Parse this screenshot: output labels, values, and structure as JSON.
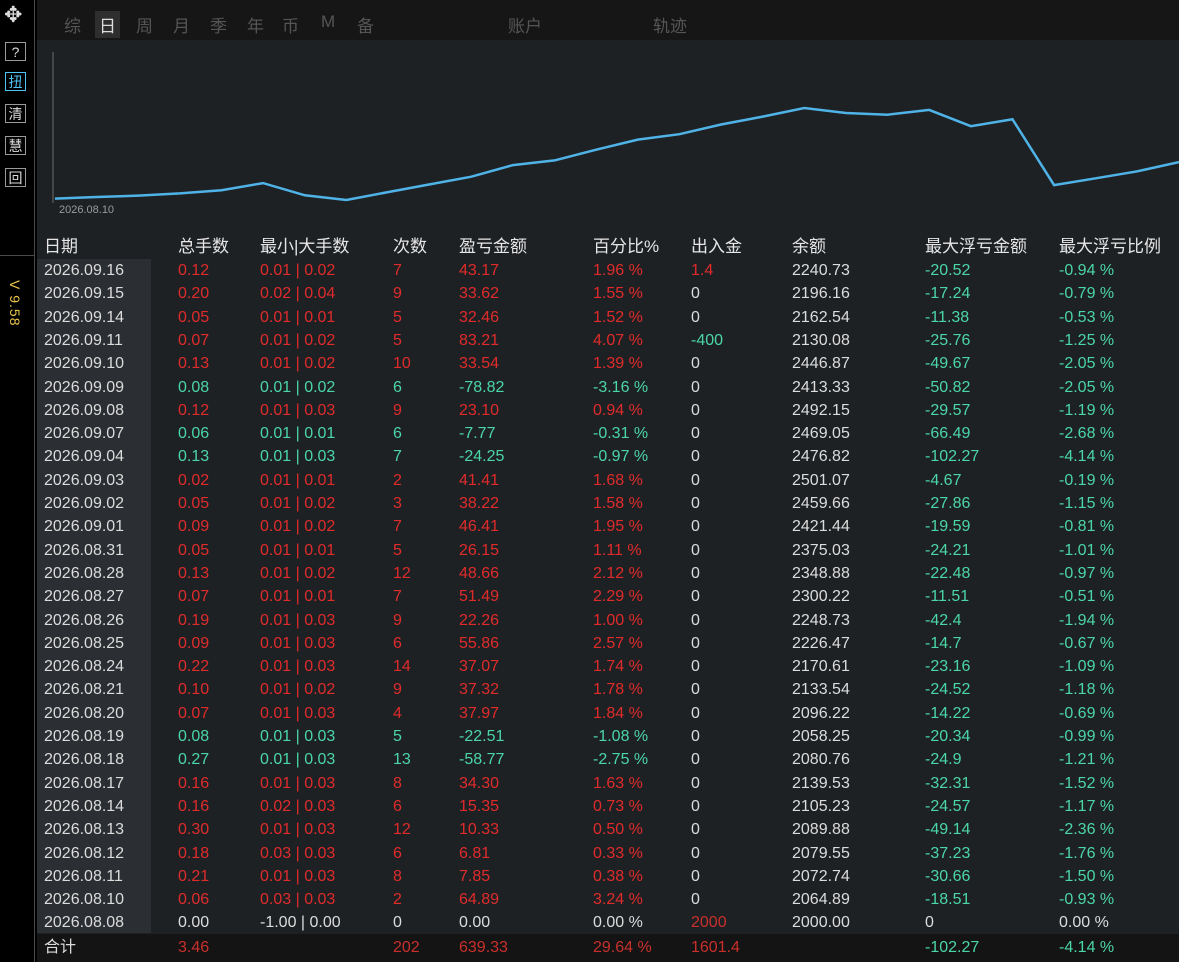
{
  "side": {
    "move_glyph": "✥",
    "buttons": [
      "?",
      "扭",
      "清",
      "慧",
      "回"
    ],
    "version": "V 9.58"
  },
  "tabs": [
    "综",
    "日",
    "周",
    "月",
    "季",
    "年",
    "币",
    "M",
    "备",
    "账户",
    "轨迹"
  ],
  "active_tab": "日",
  "chart": {
    "start_label": "2026.08.10",
    "line_color": "#4fb3e8",
    "balances": [
      2064.89,
      2072.74,
      2079.55,
      2089.88,
      2105.23,
      2139.53,
      2080.76,
      2058.25,
      2096.22,
      2133.54,
      2170.61,
      2226.47,
      2248.73,
      2300.22,
      2348.88,
      2375.03,
      2421.44,
      2459.66,
      2501.07,
      2476.82,
      2469.05,
      2492.15,
      2413.33,
      2446.87,
      2130.08,
      2162.54,
      2196.16,
      2240.73
    ]
  },
  "table": {
    "headers": [
      "日期",
      "总手数",
      "最小|大手数",
      "次数",
      "盈亏金额",
      "百分比%",
      "出入金",
      "余额",
      "最大浮亏金额",
      "最大浮亏比例"
    ],
    "rows": [
      {
        "date": "2026.09.16",
        "lots": "0.12",
        "range": "0.01 | 0.02",
        "count": "7",
        "pnl": "43.17",
        "pct": "1.96 %",
        "io": "1.4",
        "bal": "2240.73",
        "maxdd": "-20.52",
        "maxddpct": "-0.94 %",
        "tone": "r"
      },
      {
        "date": "2026.09.15",
        "lots": "0.20",
        "range": "0.02 | 0.04",
        "count": "9",
        "pnl": "33.62",
        "pct": "1.55 %",
        "io": "0",
        "bal": "2196.16",
        "maxdd": "-17.24",
        "maxddpct": "-0.79 %",
        "tone": "r"
      },
      {
        "date": "2026.09.14",
        "lots": "0.05",
        "range": "0.01 | 0.01",
        "count": "5",
        "pnl": "32.46",
        "pct": "1.52 %",
        "io": "0",
        "bal": "2162.54",
        "maxdd": "-11.38",
        "maxddpct": "-0.53 %",
        "tone": "r"
      },
      {
        "date": "2026.09.11",
        "lots": "0.07",
        "range": "0.01 | 0.02",
        "count": "5",
        "pnl": "83.21",
        "pct": "4.07 %",
        "io": "-400",
        "bal": "2130.08",
        "maxdd": "-25.76",
        "maxddpct": "-1.25 %",
        "tone": "r"
      },
      {
        "date": "2026.09.10",
        "lots": "0.13",
        "range": "0.01 | 0.02",
        "count": "10",
        "pnl": "33.54",
        "pct": "1.39 %",
        "io": "0",
        "bal": "2446.87",
        "maxdd": "-49.67",
        "maxddpct": "-2.05 %",
        "tone": "r"
      },
      {
        "date": "2026.09.09",
        "lots": "0.08",
        "range": "0.01 | 0.02",
        "count": "6",
        "pnl": "-78.82",
        "pct": "-3.16 %",
        "io": "0",
        "bal": "2413.33",
        "maxdd": "-50.82",
        "maxddpct": "-2.05 %",
        "tone": "g"
      },
      {
        "date": "2026.09.08",
        "lots": "0.12",
        "range": "0.01 | 0.03",
        "count": "9",
        "pnl": "23.10",
        "pct": "0.94 %",
        "io": "0",
        "bal": "2492.15",
        "maxdd": "-29.57",
        "maxddpct": "-1.19 %",
        "tone": "r"
      },
      {
        "date": "2026.09.07",
        "lots": "0.06",
        "range": "0.01 | 0.01",
        "count": "6",
        "pnl": "-7.77",
        "pct": "-0.31 %",
        "io": "0",
        "bal": "2469.05",
        "maxdd": "-66.49",
        "maxddpct": "-2.68 %",
        "tone": "g"
      },
      {
        "date": "2026.09.04",
        "lots": "0.13",
        "range": "0.01 | 0.03",
        "count": "7",
        "pnl": "-24.25",
        "pct": "-0.97 %",
        "io": "0",
        "bal": "2476.82",
        "maxdd": "-102.27",
        "maxddpct": "-4.14 %",
        "tone": "g"
      },
      {
        "date": "2026.09.03",
        "lots": "0.02",
        "range": "0.01 | 0.01",
        "count": "2",
        "pnl": "41.41",
        "pct": "1.68 %",
        "io": "0",
        "bal": "2501.07",
        "maxdd": "-4.67",
        "maxddpct": "-0.19 %",
        "tone": "r"
      },
      {
        "date": "2026.09.02",
        "lots": "0.05",
        "range": "0.01 | 0.02",
        "count": "3",
        "pnl": "38.22",
        "pct": "1.58 %",
        "io": "0",
        "bal": "2459.66",
        "maxdd": "-27.86",
        "maxddpct": "-1.15 %",
        "tone": "r"
      },
      {
        "date": "2026.09.01",
        "lots": "0.09",
        "range": "0.01 | 0.02",
        "count": "7",
        "pnl": "46.41",
        "pct": "1.95 %",
        "io": "0",
        "bal": "2421.44",
        "maxdd": "-19.59",
        "maxddpct": "-0.81 %",
        "tone": "r"
      },
      {
        "date": "2026.08.31",
        "lots": "0.05",
        "range": "0.01 | 0.01",
        "count": "5",
        "pnl": "26.15",
        "pct": "1.11 %",
        "io": "0",
        "bal": "2375.03",
        "maxdd": "-24.21",
        "maxddpct": "-1.01 %",
        "tone": "r"
      },
      {
        "date": "2026.08.28",
        "lots": "0.13",
        "range": "0.01 | 0.02",
        "count": "12",
        "pnl": "48.66",
        "pct": "2.12 %",
        "io": "0",
        "bal": "2348.88",
        "maxdd": "-22.48",
        "maxddpct": "-0.97 %",
        "tone": "r"
      },
      {
        "date": "2026.08.27",
        "lots": "0.07",
        "range": "0.01 | 0.01",
        "count": "7",
        "pnl": "51.49",
        "pct": "2.29 %",
        "io": "0",
        "bal": "2300.22",
        "maxdd": "-11.51",
        "maxddpct": "-0.51 %",
        "tone": "r"
      },
      {
        "date": "2026.08.26",
        "lots": "0.19",
        "range": "0.01 | 0.03",
        "count": "9",
        "pnl": "22.26",
        "pct": "1.00 %",
        "io": "0",
        "bal": "2248.73",
        "maxdd": "-42.4",
        "maxddpct": "-1.94 %",
        "tone": "r"
      },
      {
        "date": "2026.08.25",
        "lots": "0.09",
        "range": "0.01 | 0.03",
        "count": "6",
        "pnl": "55.86",
        "pct": "2.57 %",
        "io": "0",
        "bal": "2226.47",
        "maxdd": "-14.7",
        "maxddpct": "-0.67 %",
        "tone": "r"
      },
      {
        "date": "2026.08.24",
        "lots": "0.22",
        "range": "0.01 | 0.03",
        "count": "14",
        "pnl": "37.07",
        "pct": "1.74 %",
        "io": "0",
        "bal": "2170.61",
        "maxdd": "-23.16",
        "maxddpct": "-1.09 %",
        "tone": "r"
      },
      {
        "date": "2026.08.21",
        "lots": "0.10",
        "range": "0.01 | 0.02",
        "count": "9",
        "pnl": "37.32",
        "pct": "1.78 %",
        "io": "0",
        "bal": "2133.54",
        "maxdd": "-24.52",
        "maxddpct": "-1.18 %",
        "tone": "r"
      },
      {
        "date": "2026.08.20",
        "lots": "0.07",
        "range": "0.01 | 0.03",
        "count": "4",
        "pnl": "37.97",
        "pct": "1.84 %",
        "io": "0",
        "bal": "2096.22",
        "maxdd": "-14.22",
        "maxddpct": "-0.69 %",
        "tone": "r"
      },
      {
        "date": "2026.08.19",
        "lots": "0.08",
        "range": "0.01 | 0.03",
        "count": "5",
        "pnl": "-22.51",
        "pct": "-1.08 %",
        "io": "0",
        "bal": "2058.25",
        "maxdd": "-20.34",
        "maxddpct": "-0.99 %",
        "tone": "g"
      },
      {
        "date": "2026.08.18",
        "lots": "0.27",
        "range": "0.01 | 0.03",
        "count": "13",
        "pnl": "-58.77",
        "pct": "-2.75 %",
        "io": "0",
        "bal": "2080.76",
        "maxdd": "-24.9",
        "maxddpct": "-1.21 %",
        "tone": "g"
      },
      {
        "date": "2026.08.17",
        "lots": "0.16",
        "range": "0.01 | 0.03",
        "count": "8",
        "pnl": "34.30",
        "pct": "1.63 %",
        "io": "0",
        "bal": "2139.53",
        "maxdd": "-32.31",
        "maxddpct": "-1.52 %",
        "tone": "r"
      },
      {
        "date": "2026.08.14",
        "lots": "0.16",
        "range": "0.02 | 0.03",
        "count": "6",
        "pnl": "15.35",
        "pct": "0.73 %",
        "io": "0",
        "bal": "2105.23",
        "maxdd": "-24.57",
        "maxddpct": "-1.17 %",
        "tone": "r"
      },
      {
        "date": "2026.08.13",
        "lots": "0.30",
        "range": "0.01 | 0.03",
        "count": "12",
        "pnl": "10.33",
        "pct": "0.50 %",
        "io": "0",
        "bal": "2089.88",
        "maxdd": "-49.14",
        "maxddpct": "-2.36 %",
        "tone": "r"
      },
      {
        "date": "2026.08.12",
        "lots": "0.18",
        "range": "0.03 | 0.03",
        "count": "6",
        "pnl": "6.81",
        "pct": "0.33 %",
        "io": "0",
        "bal": "2079.55",
        "maxdd": "-37.23",
        "maxddpct": "-1.76 %",
        "tone": "r"
      },
      {
        "date": "2026.08.11",
        "lots": "0.21",
        "range": "0.01 | 0.03",
        "count": "8",
        "pnl": "7.85",
        "pct": "0.38 %",
        "io": "0",
        "bal": "2072.74",
        "maxdd": "-30.66",
        "maxddpct": "-1.50 %",
        "tone": "r"
      },
      {
        "date": "2026.08.10",
        "lots": "0.06",
        "range": "0.03 | 0.03",
        "count": "2",
        "pnl": "64.89",
        "pct": "3.24 %",
        "io": "0",
        "bal": "2064.89",
        "maxdd": "-18.51",
        "maxddpct": "-0.93 %",
        "tone": "r"
      },
      {
        "date": "2026.08.08",
        "lots": "0.00",
        "range": "-1.00 | 0.00",
        "count": "0",
        "pnl": "0.00",
        "pct": "0.00 %",
        "io": "2000",
        "bal": "2000.00",
        "maxdd": "0",
        "maxddpct": "0.00 %",
        "tone": "w"
      }
    ],
    "total": {
      "label": "合计",
      "lots": "3.46",
      "count": "202",
      "pnl": "639.33",
      "pct": "29.64 %",
      "io": "1601.4",
      "maxdd": "-102.27",
      "maxddpct": "-4.14 %"
    }
  },
  "colors": {
    "profit": "#e02b2b",
    "loss": "#4bd6a6",
    "neutral": "#dcdcdc"
  }
}
